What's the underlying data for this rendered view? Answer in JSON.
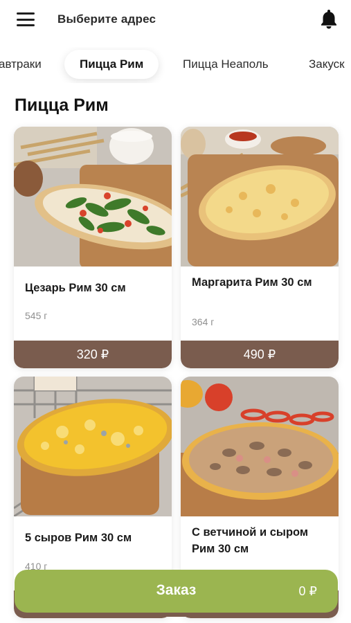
{
  "header": {
    "address_label": "Выберите адрес",
    "menu_icon": "hamburger-menu-icon",
    "bell_icon": "bell-icon"
  },
  "tabs": [
    {
      "label": "автраки",
      "active": false
    },
    {
      "label": "Пицца Рим",
      "active": true
    },
    {
      "label": "Пицца Неаполь",
      "active": false
    },
    {
      "label": "Закуск",
      "active": false
    }
  ],
  "section": {
    "title": "Пицца Рим"
  },
  "products": [
    {
      "name": "Цезарь Рим 30 см",
      "weight": "545 г",
      "price": "320 ₽"
    },
    {
      "name": "Маргарита Рим 30 см",
      "weight": "364 г",
      "price": "490 ₽"
    },
    {
      "name": "5 сыров Рим 30 см",
      "weight": "410 г",
      "price": ""
    },
    {
      "name": "С ветчиной и сыром Рим 30 см",
      "weight": "",
      "price": ""
    }
  ],
  "order": {
    "label": "Заказ",
    "total": "0 ₽"
  },
  "colors": {
    "accent_brown": "#7a5c4e",
    "order_green": "#9bb550"
  }
}
